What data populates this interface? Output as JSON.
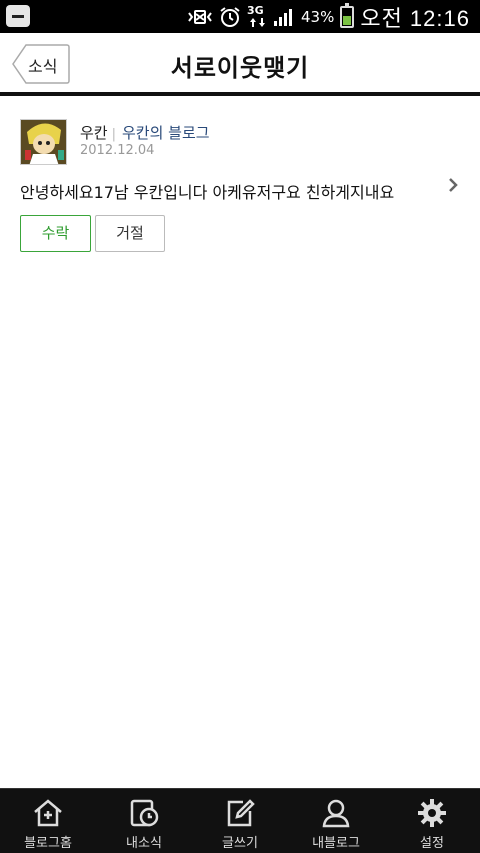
{
  "status_bar": {
    "network": "3G",
    "battery_percent": "43%",
    "time": "오전 12:16",
    "icons": [
      "menu-icon",
      "vibrate-icon",
      "alarm-icon",
      "network-3g-icon",
      "signal-icon",
      "battery-icon"
    ]
  },
  "header": {
    "back_label": "소식",
    "title": "서로이웃맺기"
  },
  "request": {
    "user_name": "우칸",
    "blog_name": "우칸의 블로그",
    "date": "2012.12.04",
    "message": "안녕하세요17남 우칸입니다 아케유저구요 친하게지내요",
    "accept_label": "수락",
    "reject_label": "거절",
    "accent_color": "#2f9c2f"
  },
  "bottom_nav": {
    "items": [
      {
        "label": "블로그홈",
        "icon": "home-icon"
      },
      {
        "label": "내소식",
        "icon": "news-clock-icon"
      },
      {
        "label": "글쓰기",
        "icon": "write-icon"
      },
      {
        "label": "내블로그",
        "icon": "profile-icon"
      },
      {
        "label": "설정",
        "icon": "gear-icon"
      }
    ]
  }
}
